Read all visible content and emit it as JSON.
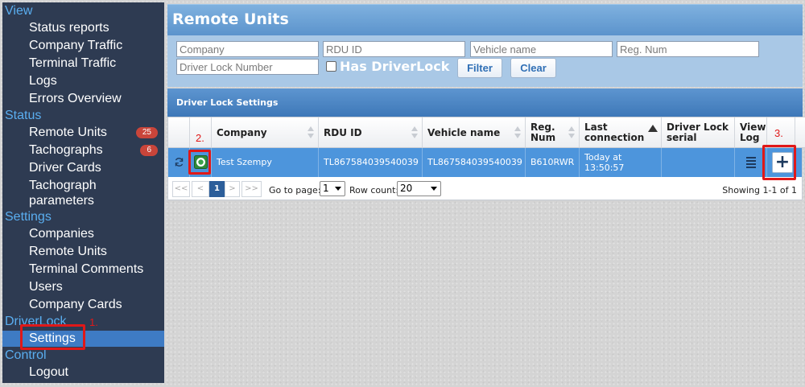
{
  "sidebar": {
    "sections": [
      {
        "header": "View",
        "items": [
          "Status reports",
          "Company Traffic",
          "Terminal Traffic",
          "Logs",
          "Errors Overview"
        ]
      },
      {
        "header": "Status",
        "items": [
          "Remote Units",
          "Tachographs",
          "Driver Cards",
          "Tachograph parameters"
        ]
      },
      {
        "header": "Settings",
        "items": [
          "Companies",
          "Remote Units",
          "Terminal Comments",
          "Users",
          "Company Cards"
        ]
      },
      {
        "header": "DriverLock",
        "items": [
          "Settings"
        ]
      },
      {
        "header": "Control",
        "items": [
          "Logout"
        ]
      }
    ],
    "badges": {
      "remote_units": "25",
      "tachographs": "6"
    },
    "tachograph_parameters_line1": "Tachograph",
    "tachograph_parameters_line2": "parameters"
  },
  "panel": {
    "title": "Remote Units"
  },
  "filters": {
    "company_placeholder": "Company",
    "rdu_id_placeholder": "RDU ID",
    "vehicle_name_placeholder": "Vehicle name",
    "reg_num_placeholder": "Reg. Num",
    "driver_lock_number_placeholder": "Driver Lock Number",
    "has_driverlock_label": "Has DriverLock",
    "filter_button": "Filter",
    "clear_button": "Clear"
  },
  "subheader": {
    "title": "Driver Lock Settings"
  },
  "table": {
    "headers": {
      "company": "Company",
      "rdu_id": "RDU ID",
      "vehicle_name": "Vehicle name",
      "reg_num_1": "Reg.",
      "reg_num_2": "Num",
      "last_connection_1": "Last",
      "last_connection_2": "connection",
      "driver_lock_serial_1": "Driver Lock",
      "driver_lock_serial_2": "serial",
      "view_log_1": "View",
      "view_log_2": "Log"
    },
    "row": {
      "company": "Test Szempy",
      "rdu_id": "TL867584039540039",
      "vehicle_name": "TL867584039540039",
      "reg_num": "B610RWR",
      "last_connection_1": "Today at",
      "last_connection_2": "13:50:57",
      "driver_lock_serial": "",
      "add_symbol": "+"
    }
  },
  "pager": {
    "first": "<<",
    "prev": "<",
    "current": "1",
    "next": ">",
    "last": ">>",
    "go_to_page_label": "Go to page:",
    "go_to_page_value": "1",
    "row_count_label": "Row count:",
    "row_count_value": "20",
    "showing": "Showing 1-1 of 1"
  },
  "callouts": {
    "one": "1.",
    "two": "2.",
    "three": "3."
  },
  "colors": {
    "accent": "#4d95dc",
    "sidebar": "#2e3b52",
    "callout": "#e01818",
    "badge": "#c9453a"
  }
}
